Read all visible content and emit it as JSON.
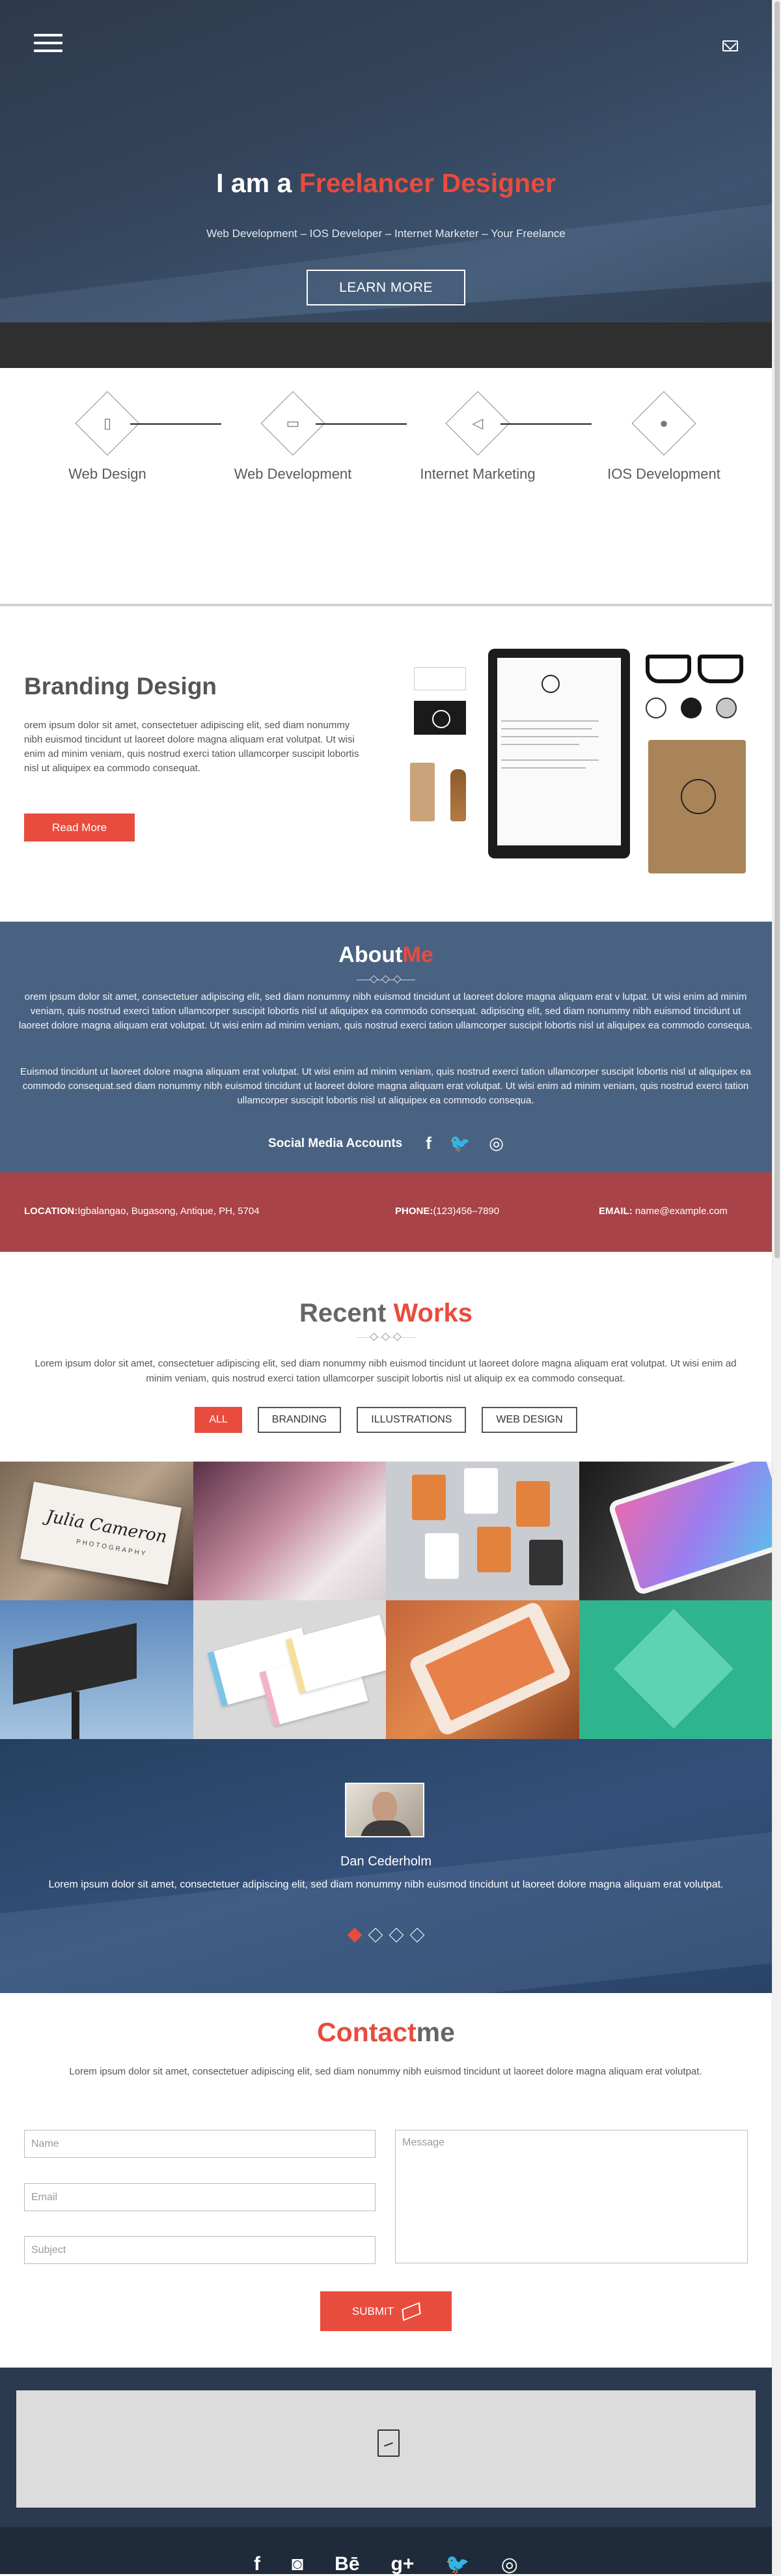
{
  "hero": {
    "title_prefix": "I am a ",
    "title_accent": "Freelancer Designer",
    "subtitle": "Web Development – IOS Developer – Internet Marketer – Your Freelance",
    "button": "LEARN MORE"
  },
  "services": [
    {
      "label": "Web Design",
      "icon": "mobile-icon"
    },
    {
      "label": "Web Development",
      "icon": "monitor-icon"
    },
    {
      "label": "Internet Marketing",
      "icon": "megaphone-icon"
    },
    {
      "label": "IOS Development",
      "icon": "apple-icon"
    }
  ],
  "branding": {
    "title": "Branding Design",
    "text": "orem ipsum dolor sit amet, consectetuer adipiscing elit, sed diam nonummy nibh euismod tincidunt ut laoreet dolore magna aliquam erat volutpat. Ut wisi enim ad minim veniam, quis nostrud exerci tation ullamcorper suscipit lobortis nisl ut aliquipex ea commodo consequat.",
    "button": "Read More"
  },
  "about": {
    "title_main": "About",
    "title_accent": "Me",
    "para1": "orem ipsum dolor sit amet, consectetuer adipiscing elit, sed diam nonummy nibh euismod tincidunt ut laoreet dolore magna aliquam erat v lutpat. Ut wisi enim ad minim veniam, quis nostrud exerci tation ullamcorper suscipit lobortis nisl ut aliquipex ea commodo consequat. adipiscing elit, sed diam nonummy nibh euismod tincidunt ut laoreet dolore magna aliquam erat volutpat. Ut wisi enim ad minim veniam, quis nostrud exerci tation ullamcorper suscipit lobortis nisl ut aliquipex ea commodo consequa.",
    "para2": "Euismod tincidunt ut laoreet dolore magna aliquam erat volutpat. Ut wisi enim ad minim veniam, quis nostrud exerci tation ullamcorper suscipit lobortis nisl ut aliquipex ea commodo consequat.sed diam nonummy nibh euismod tincidunt ut laoreet dolore magna aliquam erat volutpat. Ut wisi enim ad minim veniam, quis nostrud exerci tation ullamcorper suscipit lobortis nisl ut aliquipex ea commodo consequa.",
    "social_label": "Social Media Accounts",
    "social_icons": [
      "f",
      "🐦",
      "◎"
    ]
  },
  "info": {
    "location_label": "LOCATION:",
    "location": "Igbalangao, Bugasong, Antique, PH, 5704",
    "phone_label": "PHONE:",
    "phone": "(123)456–7890",
    "email_label": "EMAIL:",
    "email": "name@example.com"
  },
  "works": {
    "title_main": "Recent ",
    "title_accent": "Works",
    "intro": "Lorem ipsum dolor sit amet, consectetuer adipiscing elit, sed diam nonummy nibh euismod tincidunt ut laoreet dolore magna aliquam erat volutpat. Ut wisi enim ad minim veniam, quis nostrud exerci tation ullamcorper suscipit lobortis nisl ut aliquip ex ea commodo consequat.",
    "filters": [
      "ALL",
      "BRANDING",
      "ILLUSTRATIONS",
      "WEB DESIGN"
    ],
    "active_filter": "ALL",
    "tile1_card_text": "Julia Cameron",
    "tile1_card_sub": "PHOTOGRAPHY"
  },
  "testimonial": {
    "name": "Dan Cederholm",
    "quote": "Lorem ipsum dolor sit amet, consectetuer adipiscing elit, sed diam nonummy nibh euismod tincidunt ut laoreet dolore magna aliquam erat volutpat.",
    "slides": 4,
    "active_slide": 1
  },
  "contact": {
    "title_accent": "Contact",
    "title_main": "me",
    "intro": "Lorem ipsum dolor sit amet, consectetuer adipiscing elit, sed diam nonummy nibh euismod tincidunt ut laoreet dolore magna aliquam erat volutpat.",
    "name_placeholder": "Name",
    "email_placeholder": "Email",
    "subject_placeholder": "Subject",
    "message_placeholder": "Message",
    "submit": "SUBMIT"
  },
  "footer": {
    "icons": [
      "f",
      "◙",
      "Bē",
      "g+",
      "🐦",
      "◎"
    ]
  },
  "colors": {
    "accent": "#e84c3d",
    "about_bg": "#4a6282",
    "infobar_bg": "#a84348",
    "footer_bg": "#1f2a3a"
  }
}
